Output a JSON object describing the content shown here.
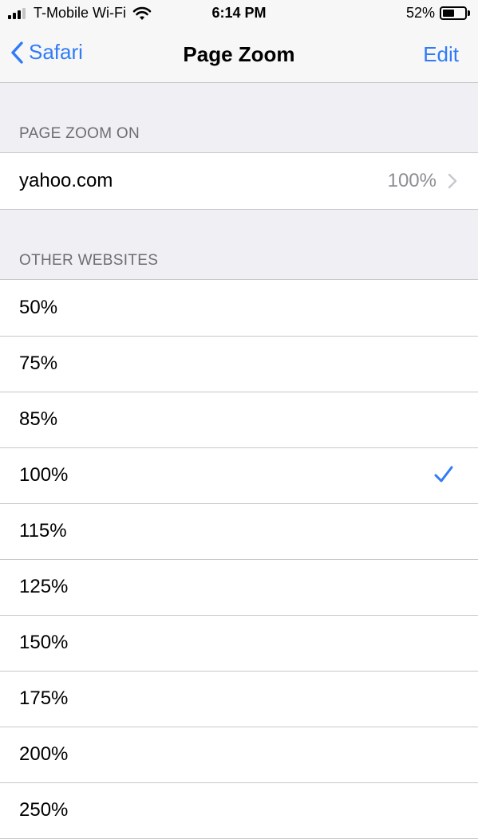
{
  "status_bar": {
    "carrier": "T-Mobile Wi-Fi",
    "time": "6:14 PM",
    "battery": "52%",
    "battery_level": 0.52,
    "signal_bars": 3
  },
  "nav": {
    "back_label": "Safari",
    "title": "Page Zoom",
    "edit_label": "Edit"
  },
  "page_zoom_on": {
    "header": "PAGE ZOOM ON",
    "sites": [
      {
        "domain": "yahoo.com",
        "zoom": "100%"
      }
    ]
  },
  "other_websites": {
    "header": "OTHER WEBSITES",
    "options": [
      "50%",
      "75%",
      "85%",
      "100%",
      "115%",
      "125%",
      "150%",
      "175%",
      "200%",
      "250%"
    ],
    "selected": "100%"
  },
  "colors": {
    "accent": "#2f7cf6",
    "background": "#efeff4",
    "separator": "#c8c7cc",
    "secondary_text": "#8e8e93",
    "header_text": "#6d6d72"
  },
  "icons": {
    "back": "chevron-left-icon",
    "disclosure": "chevron-right-icon",
    "selected": "checkmark-icon",
    "wifi": "wifi-icon",
    "battery": "battery-icon",
    "signal": "signal-icon"
  }
}
